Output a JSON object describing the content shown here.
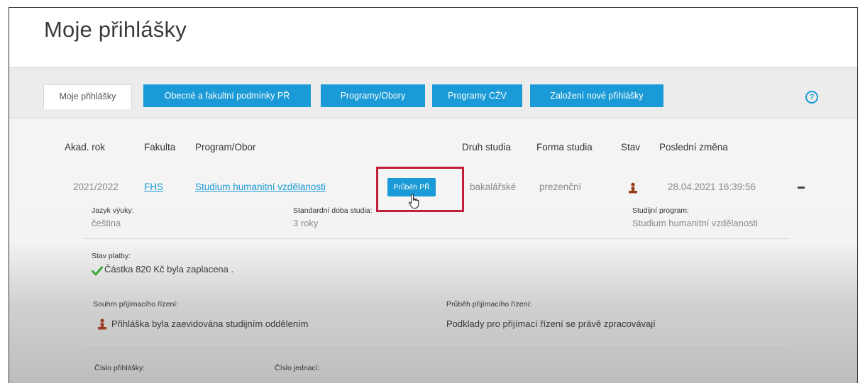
{
  "page": {
    "title": "Moje přihlášky"
  },
  "tabs": [
    {
      "label": "Moje přihlášky"
    },
    {
      "label": "Obecné a fakultní podmínky PŘ"
    },
    {
      "label": "Programy/Obory"
    },
    {
      "label": "Programy CŽV"
    },
    {
      "label": "Založení nové přihlášky"
    }
  ],
  "help": {
    "icon": "help-icon",
    "glyph": "?"
  },
  "table": {
    "headers": [
      "Akad. rok",
      "Fakulta",
      "Program/Obor",
      "Druh studia",
      "Forma studia",
      "Stav",
      "Poslední změna"
    ],
    "row": {
      "year": "2021/2022",
      "faculty": "FHS",
      "program": "Studium humanitní vzdělanosti",
      "progress_button": "Průběh PŘ",
      "type": "bakalářské",
      "form": "prezenční",
      "status_icon": "person-icon",
      "last_change": "28.04.2021 16:39:56"
    }
  },
  "details": {
    "language_label": "Jazyk výuky:",
    "language_value": "čeština",
    "duration_label": "Standardní doba studia:",
    "duration_value": "3 roky",
    "program_label": "Studijní program:",
    "program_value": "Studium humanitní vzdělanosti",
    "payment_label": "Stav platby:",
    "payment_value": "Částka 820 Kč byla zaplacena .",
    "summary_label": "Souhrn přijímacího řízení:",
    "summary_value": "Přihláška byla zaevidována studijním oddělením",
    "course_label": "Průběh přijímacího řízení:",
    "course_value": "Podklady pro přijímací řízení se právě zpracovávají",
    "application_number_label": "Číslo přihlášky:",
    "reference_number_label": "Číslo jednací:"
  },
  "colors": {
    "accent": "#1a9ad6",
    "highlight": "#c21d3a",
    "status": "#9a3b1e",
    "check": "#3aa63a"
  }
}
